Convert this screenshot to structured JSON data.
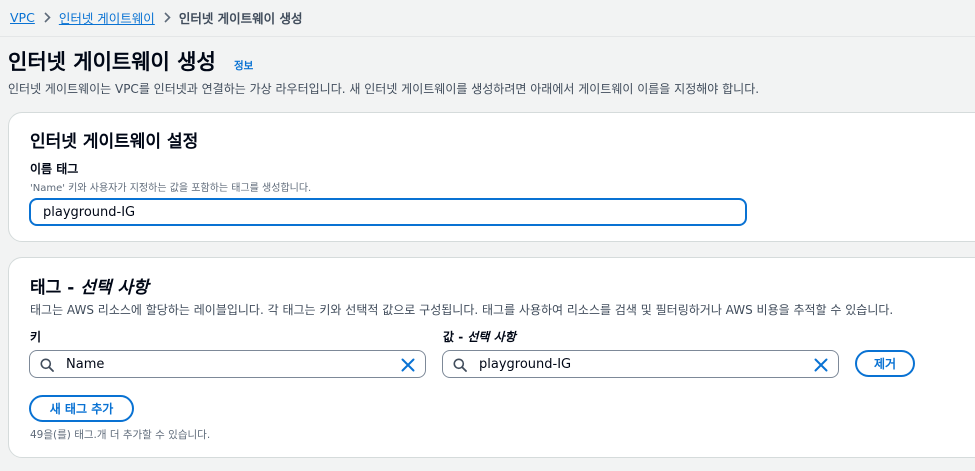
{
  "breadcrumb": {
    "items": [
      "VPC",
      "인터넷 게이트웨이"
    ],
    "current": "인터넷 게이트웨이 생성"
  },
  "page": {
    "title": "인터넷 게이트웨이 생성",
    "info_link": "정보",
    "description": "인터넷 게이트웨이는 VPC를 인터넷과 연결하는 가상 라우터입니다. 새 인터넷 게이트웨이를 생성하려면 아래에서 게이트웨이 이름을 지정해야 합니다."
  },
  "settings_panel": {
    "title": "인터넷 게이트웨이 설정",
    "name_tag_label": "이름 태그",
    "name_tag_hint": "'Name' 키와 사용자가 지정하는 값을 포함하는 태그를 생성합니다.",
    "name_tag_value": "playground-IG"
  },
  "tags_panel": {
    "title_main": "태그 - ",
    "title_optional": "선택 사항",
    "description": "태그는 AWS 리소스에 할당하는 레이블입니다. 각 태그는 키와 선택적 값으로 구성됩니다. 태그를 사용하여 리소스를 검색 및 필터링하거나 AWS 비용을 추적할 수 있습니다.",
    "key_label": "키",
    "value_label_main": "값 - ",
    "value_label_optional": "선택 사항",
    "tag": {
      "key": "Name",
      "value": "playground-IG"
    },
    "remove_button": "제거",
    "add_button": "새 태그 추가",
    "remaining_text": "49을(를) 태그.개 더 추가할 수 있습니다."
  },
  "colors": {
    "link": "#0972d3",
    "background": "#f2f3f3",
    "panel": "#ffffff",
    "text": "#000716"
  },
  "icons": {
    "breadcrumb_separator": "chevron-right-icon",
    "search": "search-icon",
    "clear": "close-icon"
  }
}
